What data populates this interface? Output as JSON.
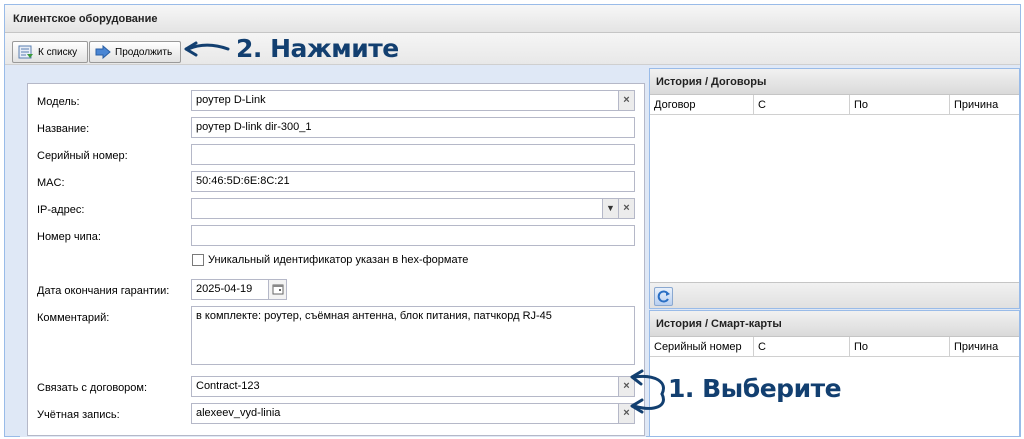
{
  "window": {
    "title": "Клиентское оборудование"
  },
  "toolbar": {
    "back_label": "К списку",
    "continue_label": "Продолжить"
  },
  "annotations": {
    "step2": "2. Нажмите",
    "step1": "1. Выберите"
  },
  "form": {
    "model": {
      "label": "Модель:",
      "value": "роутер D-Link"
    },
    "name": {
      "label": "Название:",
      "value": "роутер D-link dir-300_1"
    },
    "serial": {
      "label": "Серийный номер:",
      "value": ""
    },
    "mac": {
      "label": "MAC:",
      "value": "50:46:5D:6E:8C:21"
    },
    "ip": {
      "label": "IP-адрес:",
      "value": ""
    },
    "chip": {
      "label": "Номер чипа:",
      "value": ""
    },
    "hex_checkbox": {
      "label": "Уникальный идентификатор указан в hex-формате",
      "checked": false
    },
    "warranty": {
      "label": "Дата окончания гарантии:",
      "value": "2025-04-19"
    },
    "comment": {
      "label": "Комментарий:",
      "value": "в комплекте: роутер, съёмная антенна, блок питания, патчкорд RJ-45"
    },
    "contract": {
      "label": "Связать с договором:",
      "value": "Contract-123"
    },
    "account": {
      "label": "Учётная запись:",
      "value": "alexeev_vyd-linia"
    }
  },
  "contracts_history": {
    "title": "История / Договоры",
    "columns": [
      "Договор",
      "С",
      "По",
      "Причина"
    ]
  },
  "smartcards_history": {
    "title": "История / Смарт-карты",
    "columns": [
      "Серийный номер",
      "С",
      "По",
      "Причина"
    ]
  },
  "colors": {
    "annotation": "#123f70",
    "panel_border": "#99bbe8",
    "panel_bg": "#dfe8f6"
  }
}
